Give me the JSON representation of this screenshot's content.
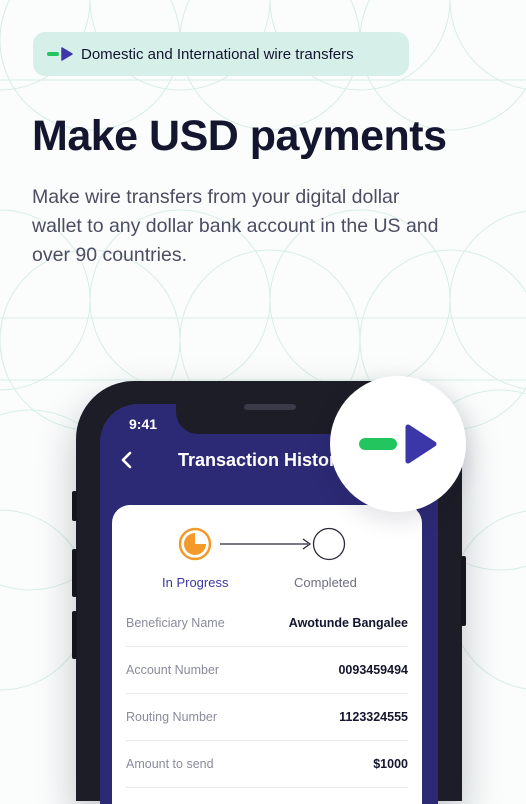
{
  "banner": {
    "text": "Domestic and International wire transfers",
    "icon": "send-arrow-icon"
  },
  "headline": "Make USD payments",
  "subtext": "Make wire transfers from your digital dollar wallet to any dollar bank account in the US and over 90 countries.",
  "phone": {
    "status_time": "9:41",
    "screen_title": "Transaction History",
    "steps": [
      {
        "label": "In Progress"
      },
      {
        "label": "Completed"
      }
    ],
    "rows": [
      {
        "label": "Beneficiary Name",
        "value": "Awotunde Bangalee"
      },
      {
        "label": "Account Number",
        "value": "0093459494"
      },
      {
        "label": "Routing Number",
        "value": "1123324555"
      },
      {
        "label": "Amount to send",
        "value": "$1000"
      }
    ]
  },
  "colors": {
    "accent_green": "#22c55e",
    "accent_purple": "#3b37a8",
    "progress_orange": "#f39a2b",
    "screen_bg": "#2d2a75",
    "pill_bg": "#d6efe9"
  }
}
